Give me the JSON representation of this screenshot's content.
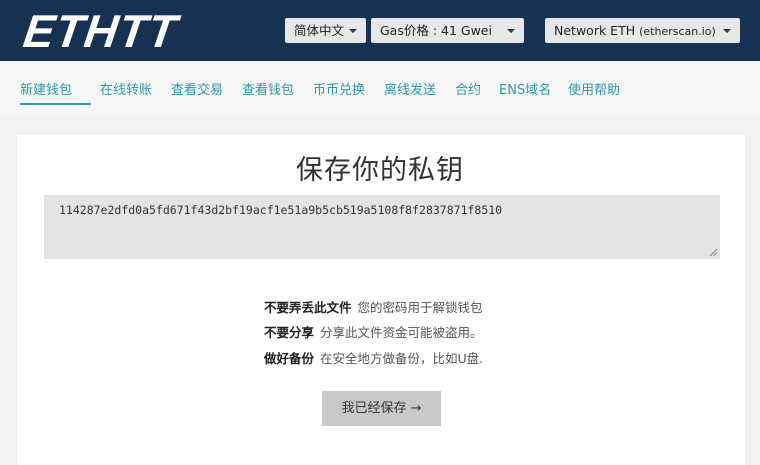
{
  "header": {
    "logo": "ETHTT",
    "language": {
      "selected": "简体中文"
    },
    "gas": {
      "label": "Gas价格 : 41 Gwei"
    },
    "network": {
      "label": "Network ETH",
      "sub": "(etherscan.io)"
    }
  },
  "nav": {
    "items": [
      {
        "label": "新建钱包"
      },
      {
        "label": "在线转账"
      },
      {
        "label": "查看交易"
      },
      {
        "label": "查看钱包"
      },
      {
        "label": "币币兑换"
      },
      {
        "label": "离线发送"
      },
      {
        "label": "合约"
      },
      {
        "label": "ENS域名"
      },
      {
        "label": "使用帮助"
      }
    ],
    "active_index": 0
  },
  "main": {
    "title": "保存你的私钥",
    "private_key": "114287e2dfd0a5fd671f43d2bf19acf1e51a9b5cb519a5108f8f2837871f8510",
    "notes": [
      {
        "bold": "不要弄丢此文件",
        "text": "您的密码用于解锁钱包"
      },
      {
        "bold": "不要分享",
        "text": "分享此文件资金可能被盗用。"
      },
      {
        "bold": "做好备份",
        "text": "在安全地方做备份，比如U盘."
      }
    ],
    "saved_button": "我已经保存 →"
  },
  "colors": {
    "header_bg": "#163151",
    "accent": "#2a9ba9",
    "page_bg": "#f2f2f2"
  }
}
